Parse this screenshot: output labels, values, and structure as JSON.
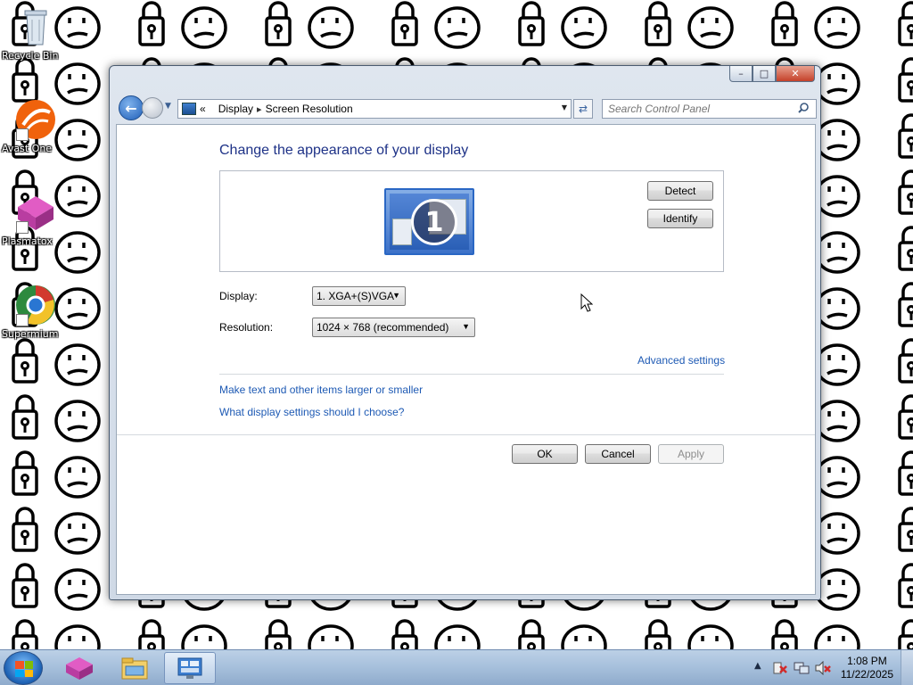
{
  "desktop": {
    "icons": [
      {
        "label": "Recycle Bin"
      },
      {
        "label": "Avast One"
      },
      {
        "label": "Plasmatox"
      },
      {
        "label": "Supermium"
      }
    ]
  },
  "window": {
    "caption": {
      "minimize": "–",
      "maximize": "□",
      "close": "✕"
    },
    "address": {
      "prefix": "«",
      "crumbs": [
        "Display",
        "Screen Resolution"
      ],
      "separator": "▸"
    },
    "search": {
      "placeholder": "Search Control Panel"
    },
    "heading": "Change the appearance of your display",
    "monitor_number": "1",
    "detect_label": "Detect",
    "identify_label": "Identify",
    "display": {
      "label": "Display:",
      "value": "1. XGA+(S)VGA"
    },
    "resolution": {
      "label": "Resolution:",
      "value": "1024 × 768 (recommended)"
    },
    "advanced_link": "Advanced settings",
    "links": [
      "Make text and other items larger or smaller",
      "What display settings should I choose?"
    ],
    "buttons": {
      "ok": "OK",
      "cancel": "Cancel",
      "apply": "Apply"
    }
  },
  "taskbar": {
    "clock_time": "1:08 PM",
    "clock_date": "11/22/2025"
  },
  "colors": {
    "link": "#1e5ab4",
    "heading": "#1e3287",
    "window_frame": "#cfd9e6"
  }
}
